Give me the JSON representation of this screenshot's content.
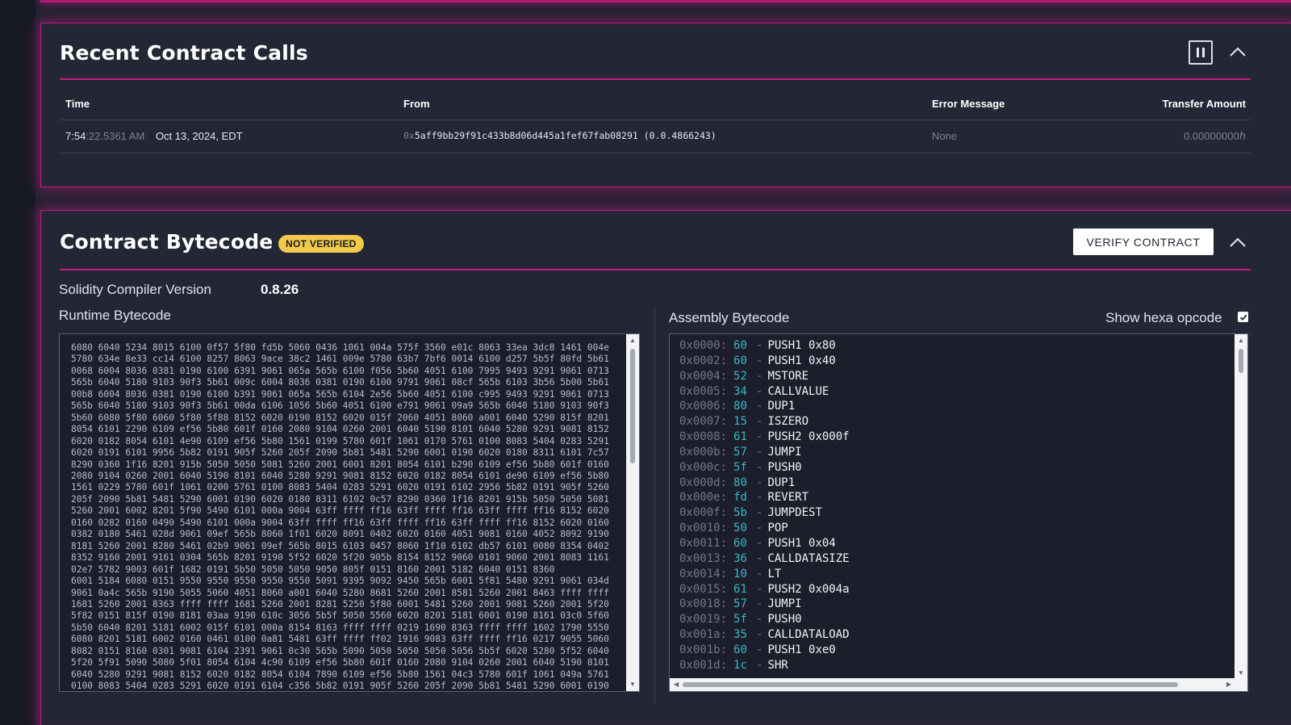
{
  "recent_calls": {
    "title": "Recent Contract Calls",
    "columns": {
      "time": "Time",
      "from": "From",
      "error": "Error Message",
      "amount": "Transfer Amount"
    },
    "rows": [
      {
        "time_main": "7:54",
        "time_rest": ":22.5361 AM",
        "date": "Oct 13, 2024, EDT",
        "from_prefix": "0x",
        "from_address": "5aff9bb29f91c433b8d06d445a1fef67fab08291 (0.0.4866243)",
        "error": "None",
        "amount": "0.00000000ℏ"
      }
    ]
  },
  "bytecode": {
    "title": "Contract Bytecode",
    "badge": "NOT VERIFIED",
    "verify_button": "VERIFY CONTRACT",
    "compiler_label": "Solidity Compiler Version",
    "compiler_version": "0.8.26",
    "runtime_label": "Runtime Bytecode",
    "assembly_label": "Assembly Bytecode",
    "show_hexa_label": "Show hexa opcode",
    "show_hexa_checked": true,
    "runtime_lines": [
      "6080 6040 5234 8015 6100 0f57 5f80 fd5b 5060 0436 1061 004a 575f 3560 e01c 8063 33ea 3dc8 1461 004e",
      "5780 634e 8e33 cc14 6100 8257 8063 9ace 38c2 1461 009e 5780 63b7 7bf6 0014 6100 d257 5b5f 80fd 5b61",
      "0068 6004 8036 0381 0190 6100 6391 9061 065a 565b 6100 f056 5b60 4051 6100 7995 9493 9291 9061 0713",
      "565b 6040 5180 9103 90f3 5b61 009c 6004 8036 0381 0190 6100 9791 9061 08cf 565b 6103 3b56 5b00 5b61",
      "00b8 6004 8036 0381 0190 6100 b391 9061 065a 565b 6104 2e56 5b60 4051 6100 c995 9493 9291 9061 0713",
      "565b 6040 5180 9103 90f3 5b61 00da 6106 1056 5b60 4051 6100 e791 9061 09a9 565b 6040 5180 9103 90f3",
      "5b60 6080 5f80 6060 5f80 5f88 8152 6020 0190 8152 6020 015f 2060 4051 8060 a001 6040 5290 815f 8201",
      "8054 6101 2290 6109 ef56 5b80 601f 0160 2080 9104 0260 2001 6040 5190 8101 6040 5280 9291 9081 8152",
      "6020 0182 8054 6101 4e90 6109 ef56 5b80 1561 0199 5780 601f 1061 0170 5761 0100 8083 5404 0283 5291",
      "6020 0191 6101 9956 5b82 0191 905f 5260 205f 2090 5b81 5481 5290 6001 0190 6020 0180 8311 6101 7c57",
      "8290 0360 1f16 8201 915b 5050 5050 5081 5260 2001 6001 8201 8054 6101 b290 6109 ef56 5b80 601f 0160",
      "2080 9104 0260 2001 6040 5190 8101 6040 5280 9291 9081 8152 6020 0182 8054 6101 de90 6109 ef56 5b80",
      "1561 0229 5780 601f 1061 0200 5761 0100 8083 5404 0283 5291 6020 0191 6102 2956 5b82 0191 905f 5260",
      "205f 2090 5b81 5481 5290 6001 0190 6020 0180 8311 6102 0c57 8290 0360 1f16 8201 915b 5050 5050 5081",
      "5260 2001 6002 8201 5f90 5490 6101 000a 9004 63ff ffff ff16 63ff ffff ff16 63ff ffff ff16 8152 6020",
      "0160 0282 0160 0490 5490 6101 000a 9004 63ff ffff ff16 63ff ffff ff16 63ff ffff ff16 8152 6020 0160",
      "0382 0180 5461 028d 9061 09ef 565b 8060 1f01 6020 8091 0402 6020 0160 4051 9081 0160 4052 8092 9190",
      "8181 5260 2001 8280 5461 02b9 9061 09ef 565b 8015 6103 0457 8060 1f10 6102 db57 6101 0080 8354 0402",
      "8352 9160 2001 9161 0304 565b 8201 9190 5f52 6020 5f20 905b 8154 8152 9060 0101 9060 2001 8083 1161",
      "02e7 5782 9003 601f 1682 0191 5b50 5050 5050 9050 805f 0151 8160 2001 5182 6040 0151 8360",
      "6001 5184 6080 0151 9550 9550 9550 9550 9550 5091 9395 9092 9450 565b 6001 5f81 5480 9291 9061 034d",
      "9061 0a4c 565b 9190 5055 5060 4051 8060 a001 6040 5280 8681 5260 2001 8581 5260 2001 8463 ffff ffff",
      "1681 5260 2001 8363 ffff ffff 1681 5260 2001 8281 5250 5f80 6001 5481 5260 2001 9081 5260 2001 5f20",
      "5f82 0151 815f 0190 8181 03aa 9190 610c 3056 5b5f 5050 5560 6020 8201 5181 6001 0190 8161 03c0 5f60",
      "5b50 6040 8201 5181 6002 015f 6101 000a 8154 8163 ffff ffff 0219 1690 8363 ffff ffff 1602 1790 5550",
      "6080 8201 5181 6002 0160 0461 0100 0a81 5481 63ff ffff ff02 1916 9083 63ff ffff ff16 0217 9055 5060",
      "8082 0151 8160 0301 9081 6104 2391 9061 0c30 565b 5090 5050 5050 5050 5056 5b5f 6020 5280 5f52 6040",
      "5f20 5f91 5090 5080 5f01 8054 6104 4c90 6109 ef56 5b80 601f 0160 2080 9104 0260 2001 6040 5190 8101",
      "6040 5280 9291 9081 8152 6020 0182 8054 6104 7890 6109 ef56 5b80 1561 04c3 5780 601f 1061 049a 5761",
      "0100 8083 5404 0283 5291 6020 0191 6104 c356 5b82 0191 905f 5260 205f 2090 5b81 5481 5290 6001 0190"
    ],
    "assembly": [
      {
        "addr": "0x0000:",
        "hex": "60",
        "op": "PUSH1 0x80"
      },
      {
        "addr": "0x0002:",
        "hex": "60",
        "op": "PUSH1 0x40"
      },
      {
        "addr": "0x0004:",
        "hex": "52",
        "op": "MSTORE"
      },
      {
        "addr": "0x0005:",
        "hex": "34",
        "op": "CALLVALUE"
      },
      {
        "addr": "0x0006:",
        "hex": "80",
        "op": "DUP1"
      },
      {
        "addr": "0x0007:",
        "hex": "15",
        "op": "ISZERO"
      },
      {
        "addr": "0x0008:",
        "hex": "61",
        "op": "PUSH2 0x000f"
      },
      {
        "addr": "0x000b:",
        "hex": "57",
        "op": "JUMPI"
      },
      {
        "addr": "0x000c:",
        "hex": "5f",
        "op": "PUSH0"
      },
      {
        "addr": "0x000d:",
        "hex": "80",
        "op": "DUP1"
      },
      {
        "addr": "0x000e:",
        "hex": "fd",
        "op": "REVERT"
      },
      {
        "addr": "0x000f:",
        "hex": "5b",
        "op": "JUMPDEST"
      },
      {
        "addr": "0x0010:",
        "hex": "50",
        "op": "POP"
      },
      {
        "addr": "0x0011:",
        "hex": "60",
        "op": "PUSH1 0x04"
      },
      {
        "addr": "0x0013:",
        "hex": "36",
        "op": "CALLDATASIZE"
      },
      {
        "addr": "0x0014:",
        "hex": "10",
        "op": "LT"
      },
      {
        "addr": "0x0015:",
        "hex": "61",
        "op": "PUSH2 0x004a"
      },
      {
        "addr": "0x0018:",
        "hex": "57",
        "op": "JUMPI"
      },
      {
        "addr": "0x0019:",
        "hex": "5f",
        "op": "PUSH0"
      },
      {
        "addr": "0x001a:",
        "hex": "35",
        "op": "CALLDATALOAD"
      },
      {
        "addr": "0x001b:",
        "hex": "60",
        "op": "PUSH1 0xe0"
      },
      {
        "addr": "0x001d:",
        "hex": "1c",
        "op": "SHR"
      }
    ]
  },
  "colors": {
    "accent_magenta": "#c8197f",
    "badge_yellow": "#f2c94c",
    "opcode_hex": "#38b6c7"
  },
  "icons": [
    "pause-icon",
    "chevron-up-icon",
    "checkmark-icon"
  ]
}
